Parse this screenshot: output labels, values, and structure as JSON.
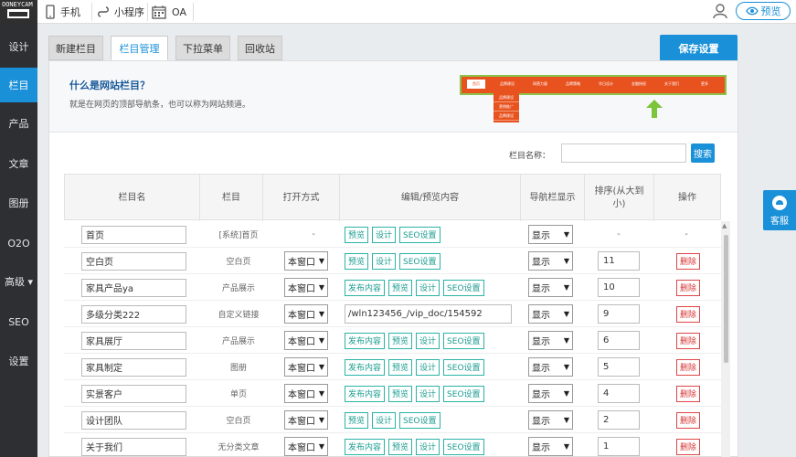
{
  "topbar": {
    "logo_text": "OONEYCAM",
    "nav": [
      {
        "label": "手机",
        "icon": "phone-icon"
      },
      {
        "label": "小程序",
        "icon": "miniprogram-icon"
      },
      {
        "label": "OA",
        "icon": "calendar-icon"
      }
    ],
    "preview_label": "预览"
  },
  "sidebar": {
    "items": [
      {
        "label": "设计"
      },
      {
        "label": "栏目",
        "active": true
      },
      {
        "label": "产品"
      },
      {
        "label": "文章"
      },
      {
        "label": "图册"
      },
      {
        "label": "O2O"
      },
      {
        "label": "高级 ▾"
      },
      {
        "label": "SEO"
      },
      {
        "label": "设置"
      }
    ]
  },
  "tabs": [
    {
      "label": "新建栏目"
    },
    {
      "label": "栏目管理",
      "active": true
    },
    {
      "label": "下拉菜单"
    },
    {
      "label": "回收站"
    }
  ],
  "save_label": "保存设置",
  "intro": {
    "title": "什么是网站栏目？",
    "desc": "就是在网页的顶部导航条，也可以称为网站频道。",
    "demo_nav": [
      "首页",
      "品牌建设",
      "网营力量",
      "品牌策略",
      "华日设计",
      "金融授权",
      "关于我们",
      "更多"
    ],
    "demo_drop": [
      "品牌建设",
      "营销推广",
      "品牌建设"
    ]
  },
  "search": {
    "label": "栏目名称：",
    "value": "",
    "button": "搜索"
  },
  "table": {
    "headers": [
      "栏目名",
      "栏目",
      "打开方式",
      "编辑/预览内容",
      "导航栏显示",
      "排序(从大到小)",
      "操作"
    ],
    "rows": [
      {
        "name": "首页",
        "type": "[系统]首页",
        "open": "-",
        "buttons": [
          "预览",
          "设计",
          "SEO设置"
        ],
        "show": "显示",
        "order": "-",
        "action": "-"
      },
      {
        "name": "空白页",
        "type": "空白页",
        "open": "本窗口",
        "buttons": [
          "预览",
          "设计",
          "SEO设置"
        ],
        "show": "显示",
        "order": "11",
        "action": "删除"
      },
      {
        "name": "家具产品ya",
        "type": "产品展示",
        "open": "本窗口",
        "buttons": [
          "发布内容",
          "预览",
          "设计",
          "SEO设置"
        ],
        "show": "显示",
        "order": "10",
        "action": "删除"
      },
      {
        "name": "多级分类222",
        "type": "自定义链接",
        "open": "本窗口",
        "link": "/wln123456_/vip_doc/154592",
        "show": "显示",
        "order": "9",
        "action": "删除"
      },
      {
        "name": "家具展厅",
        "type": "产品展示",
        "open": "本窗口",
        "buttons": [
          "发布内容",
          "预览",
          "设计",
          "SEO设置"
        ],
        "show": "显示",
        "order": "6",
        "action": "删除"
      },
      {
        "name": "家具制定",
        "type": "图册",
        "open": "本窗口",
        "buttons": [
          "发布内容",
          "预览",
          "设计",
          "SEO设置"
        ],
        "show": "显示",
        "order": "5",
        "action": "删除"
      },
      {
        "name": "实景客户",
        "type": "单页",
        "open": "本窗口",
        "buttons": [
          "发布内容",
          "预览",
          "设计",
          "SEO设置"
        ],
        "show": "显示",
        "order": "4",
        "action": "删除"
      },
      {
        "name": "设计团队",
        "type": "空白页",
        "open": "本窗口",
        "buttons": [
          "预览",
          "设计",
          "SEO设置"
        ],
        "show": "显示",
        "order": "2",
        "action": "删除"
      },
      {
        "name": "关于我们",
        "type": "无分类文章",
        "open": "本窗口",
        "buttons": [
          "发布内容",
          "预览",
          "设计",
          "SEO设置"
        ],
        "show": "显示",
        "order": "1",
        "action": "删除"
      }
    ]
  },
  "service_label": "客服",
  "colors": {
    "accent": "#1a90d8",
    "sidebar": "#2d2f33",
    "teal": "#2bb3a7",
    "danger": "#e04545",
    "demo_bar": "#e8521f"
  }
}
